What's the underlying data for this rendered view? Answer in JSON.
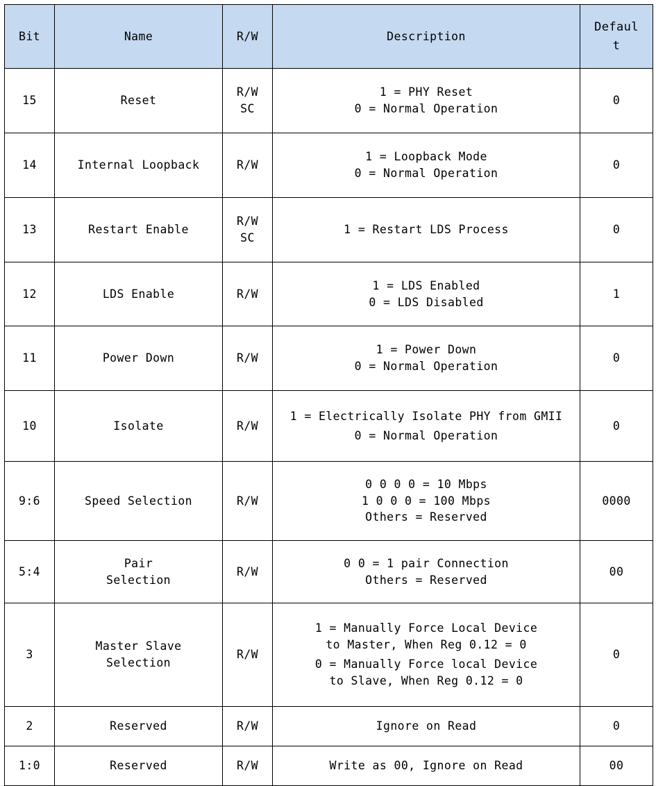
{
  "table": {
    "headers": {
      "bit": "Bit",
      "name": "Name",
      "rw": "R/W",
      "description": "Description",
      "default_line1": "Defaul",
      "default_line2": "t"
    },
    "header_bg": "#c5d9f1",
    "rows": [
      {
        "bit": "15",
        "name": "Reset",
        "rw_line1": "R/W",
        "rw_line2": "SC",
        "desc_line1": "1 = PHY Reset",
        "desc_line2": "0 = Normal Operation",
        "default": "0"
      },
      {
        "bit": "14",
        "name": "Internal Loopback",
        "rw_line1": "R/W",
        "rw_line2": "",
        "desc_line1": "1 = Loopback Mode",
        "desc_line2": "0 = Normal Operation",
        "default": "0"
      },
      {
        "bit": "13",
        "name": "Restart Enable",
        "rw_line1": "R/W",
        "rw_line2": "SC",
        "desc_line1": "1 = Restart LDS Process",
        "desc_line2": "",
        "default": "0"
      },
      {
        "bit": "12",
        "name": "LDS Enable",
        "rw_line1": "R/W",
        "rw_line2": "",
        "desc_line1": "1 = LDS Enabled",
        "desc_line2": "0 = LDS Disabled",
        "default": "1"
      },
      {
        "bit": "11",
        "name": "Power Down",
        "rw_line1": "R/W",
        "rw_line2": "",
        "desc_line1": "1 = Power Down",
        "desc_line2": "0 = Normal Operation",
        "default": "0"
      },
      {
        "bit": "10",
        "name": "Isolate",
        "rw_line1": "R/W",
        "rw_line2": "",
        "desc_line1": "1 = Electrically Isolate PHY from GMII",
        "desc_line2": "0 = Normal Operation",
        "default": "0"
      },
      {
        "bit": "9:6",
        "name": "Speed Selection",
        "rw_line1": "R/W",
        "rw_line2": "",
        "desc_line1": "0 0 0 0 = 10 Mbps",
        "desc_line2": "1 0 0 0 = 100 Mbps",
        "desc_line3": "Others = Reserved",
        "default": "0000"
      },
      {
        "bit": "5:4",
        "name_line1": "Pair",
        "name_line2": "Selection",
        "rw_line1": "R/W",
        "rw_line2": "",
        "desc_line1": "0 0 = 1 pair Connection",
        "desc_line2": "Others = Reserved",
        "default": "00"
      },
      {
        "bit": "3",
        "name_line1": "Master Slave",
        "name_line2": "Selection",
        "rw_line1": "R/W",
        "rw_line2": "",
        "desc_line1": "1 = Manually Force Local Device",
        "desc_line2": "to Master, When Reg 0.12 = 0",
        "desc_line3": "0 = Manually Force local Device",
        "desc_line4": "to Slave, When Reg 0.12 = 0",
        "default": "0"
      },
      {
        "bit": "2",
        "name": "Reserved",
        "rw_line1": "R/W",
        "rw_line2": "",
        "desc_line1": "Ignore on Read",
        "desc_line2": "",
        "default": "0"
      },
      {
        "bit": "1:0",
        "name": "Reserved",
        "rw_line1": "R/W",
        "rw_line2": "",
        "desc_line1": "Write as 00, Ignore on Read",
        "desc_line2": "",
        "default": "00"
      }
    ]
  }
}
